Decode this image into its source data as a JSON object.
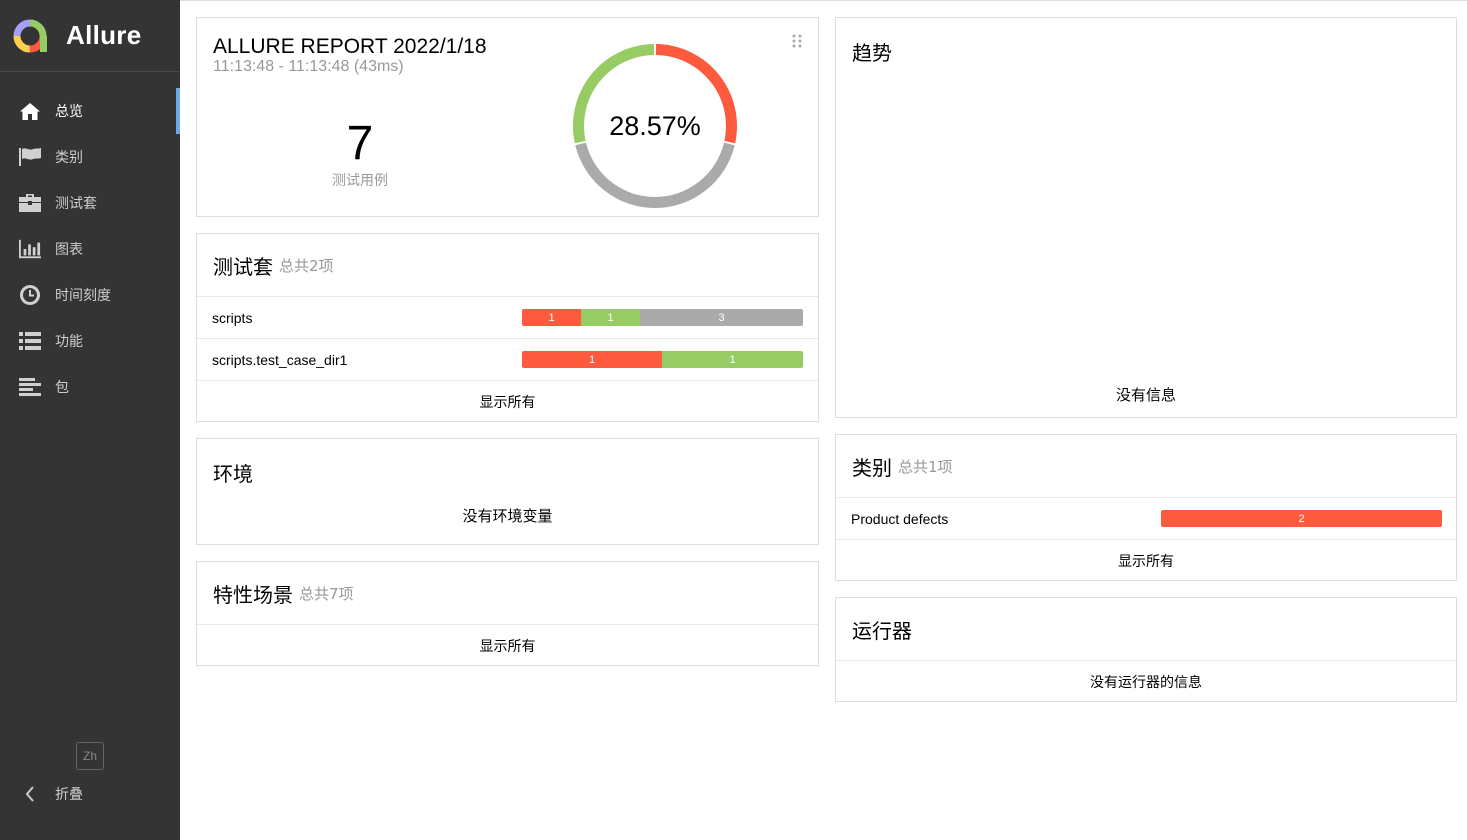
{
  "brand": {
    "name": "Allure"
  },
  "nav": {
    "items": [
      {
        "label": "总览",
        "icon": "home-icon",
        "active": true
      },
      {
        "label": "类别",
        "icon": "flag-icon",
        "active": false
      },
      {
        "label": "测试套",
        "icon": "briefcase-icon",
        "active": false
      },
      {
        "label": "图表",
        "icon": "bar-chart-icon",
        "active": false
      },
      {
        "label": "时间刻度",
        "icon": "clock-icon",
        "active": false
      },
      {
        "label": "功能",
        "icon": "list-icon",
        "active": false
      },
      {
        "label": "包",
        "icon": "align-left-icon",
        "active": false
      }
    ],
    "lang": "Zh",
    "collapse_label": "折叠"
  },
  "summary": {
    "title": "ALLURE REPORT 2022/1/18",
    "time": "11:13:48 - 11:13:48 (43ms)",
    "total": "7",
    "total_label": "测试用例",
    "percent": "28.57%",
    "donut": {
      "failed": 2,
      "passed": 2,
      "unknown": 3
    }
  },
  "suites": {
    "title": "测试套",
    "subtitle": "总共2项",
    "rows": [
      {
        "name": "scripts",
        "segments": [
          {
            "status": "failed",
            "value": 1
          },
          {
            "status": "passed",
            "value": 1
          },
          {
            "status": "unknown",
            "value": 3
          }
        ]
      },
      {
        "name": "scripts.test_case_dir1",
        "segments": [
          {
            "status": "failed",
            "value": 1
          },
          {
            "status": "passed",
            "value": 1
          }
        ]
      }
    ],
    "show_all": "显示所有"
  },
  "environment": {
    "title": "环境",
    "empty": "没有环境变量"
  },
  "features": {
    "title": "特性场景",
    "subtitle": "总共7项",
    "show_all": "显示所有"
  },
  "trend": {
    "title": "趋势",
    "empty": "没有信息"
  },
  "categories": {
    "title": "类别",
    "subtitle": "总共1项",
    "rows": [
      {
        "name": "Product defects",
        "segments": [
          {
            "status": "failed",
            "value": 2
          }
        ]
      }
    ],
    "show_all": "显示所有"
  },
  "executors": {
    "title": "运行器",
    "empty": "没有运行器的信息"
  },
  "colors": {
    "failed": "#fd5a3e",
    "passed": "#97cc64",
    "unknown": "#aaaaaa",
    "sidebar": "#343434",
    "accent": "#6aa8e6"
  }
}
